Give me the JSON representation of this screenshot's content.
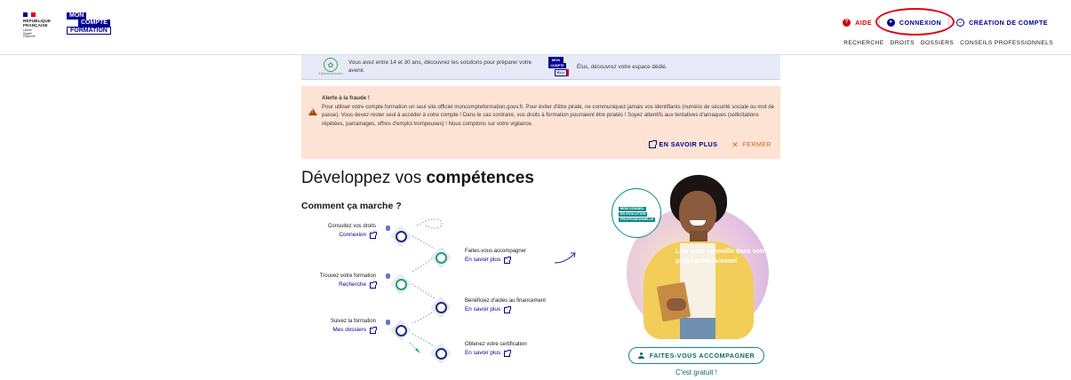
{
  "header": {
    "republique_lines": [
      "RÉPUBLIQUE",
      "FRANÇAISE"
    ],
    "republique_motto": [
      "Liberté",
      "Égalité",
      "Fraternité"
    ],
    "mcf_logo": [
      "MON",
      "COMPTE",
      "FORMATION"
    ],
    "top_links": {
      "aide": "AIDE",
      "connexion": "CONNEXION",
      "creation": "CRÉATION DE COMPTE"
    },
    "nav": [
      "RECHERCHE",
      "DROITS",
      "DOSSIERS",
      "CONSEILS PROFESSIONNELS"
    ]
  },
  "jeunes_banner": {
    "logo_tag": "#1jeune1solution",
    "text": "Vous avez entre 14 et 30 ans, découvrez les solutions pour préparer votre avenir.",
    "elus_logo": [
      "MON",
      "COMPTE",
      "ÉLU"
    ],
    "elus_text": "Élus, découvrez votre espace dédié."
  },
  "alert": {
    "title": "Alerte à la fraude !",
    "body": "Pour utiliser votre compte formation un seul site officiel moncompteformation.gouv.fr. Pour éviter d'être piraté, ne communiquez jamais vos identifiants (numéro de sécurité sociale ou mot de passe). Vous devez rester seul à accéder à votre compte ! Dans le cas contraire, vos droits à formation pourraient être piratés ! Soyez attentifs aux tentatives d'arnaques (sollicitations répétées, parrainages, offres d'emploi trompeuses) ! Nous comptons sur votre vigilance.",
    "more": "EN SAVOIR PLUS",
    "close": "FERMER"
  },
  "main": {
    "title_prefix": "Développez vos ",
    "title_bold": "compétences",
    "subtitle": "Comment ça marche ?",
    "steps": [
      {
        "title": "Consultez vos droits",
        "link": "Connexion"
      },
      {
        "title": "Faites-vous accompagner",
        "link": "En savoir plus"
      },
      {
        "title": "Trouvez votre formation",
        "link": "Recherche"
      },
      {
        "title": "Bénéficiez d'aides au financement",
        "link": "En savoir plus"
      },
      {
        "title": "Suivez la formation",
        "link": "Mes dossiers"
      },
      {
        "title": "Obtenez votre certification",
        "link": "En savoir plus"
      }
    ]
  },
  "promo": {
    "badge": [
      "MON CONSEIL",
      "EN ÉVOLUTION",
      "PROFESSIONNELLE"
    ],
    "lisa": "Lisa vous conseille dans votre projet professionnel",
    "button": "FAITES-VOUS ACCOMPAGNER",
    "free": "C'est gratuit !"
  },
  "colors": {
    "brand_blue": "#000091",
    "alert_bg": "#fde3d4",
    "accent_teal": "#0b8a8a",
    "highlight_ring": "#e1000f"
  }
}
